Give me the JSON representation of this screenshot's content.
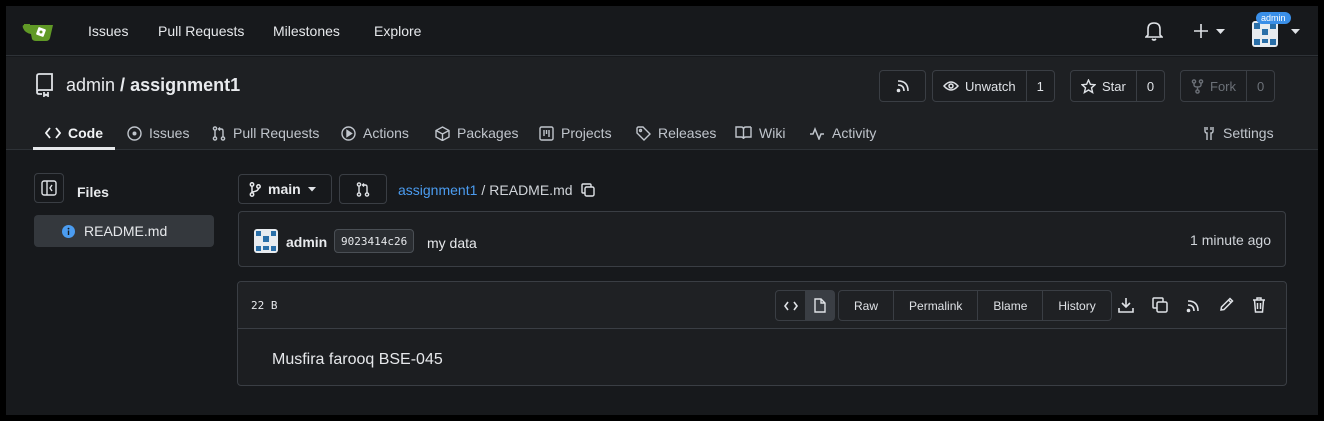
{
  "nav": {
    "links": [
      "Issues",
      "Pull Requests",
      "Milestones",
      "Explore"
    ],
    "user_badge": "admin",
    "icons": [
      "tea-logo-icon",
      "bell-icon",
      "plus-icon",
      "chevron-down-icon"
    ]
  },
  "repo": {
    "owner": "admin",
    "separator": "/",
    "name": "assignment1",
    "watch_label": "Unwatch",
    "watch_count": "1",
    "star_label": "Star",
    "star_count": "0",
    "fork_label": "Fork",
    "fork_count": "0"
  },
  "tabs": {
    "code": "Code",
    "issues": "Issues",
    "pull_requests": "Pull Requests",
    "actions": "Actions",
    "packages": "Packages",
    "projects": "Projects",
    "releases": "Releases",
    "wiki": "Wiki",
    "activity": "Activity",
    "settings": "Settings"
  },
  "sidebar": {
    "title": "Files",
    "files": [
      "README.md"
    ]
  },
  "branch": {
    "name": "main",
    "path_repo": "assignment1",
    "path_sep": "/",
    "path_file": "README.md"
  },
  "commit": {
    "user": "admin",
    "sha": "9023414c26",
    "message": "my data",
    "time": "1 minute ago"
  },
  "file": {
    "size": "22 B",
    "actions": [
      "Raw",
      "Permalink",
      "Blame",
      "History"
    ],
    "content": "Musfira farooq BSE-045"
  },
  "colors": {
    "accent_link": "#4b9cf0",
    "logo_green": "#609926",
    "badge_blue": "#3a8fe8",
    "info_blue": "#4b9cf0"
  }
}
